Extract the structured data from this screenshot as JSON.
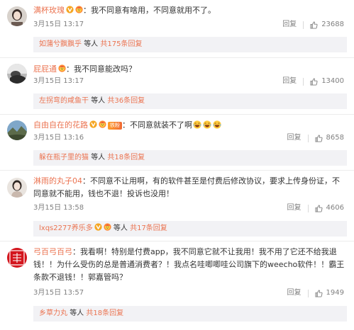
{
  "comments": [
    {
      "username": "满杯玫瑰",
      "text": "我不同意有啥用，不同意就用不了。",
      "date": "3月15日 13:17",
      "reply_label": "回复",
      "likes": "23688",
      "sub": {
        "users": [
          "如蒲兮飘飘乎"
        ],
        "etc": "等人",
        "more": "共175条回复"
      }
    },
    {
      "username": "屁屁通",
      "text": "我不同意能改吗？",
      "date": "3月15日 13:17",
      "reply_label": "回复",
      "likes": "13400",
      "sub": {
        "users": [
          "左拐弯的咸鱼干"
        ],
        "etc": "等人",
        "more": "共36条回复"
      }
    },
    {
      "username": "自由自在的花路",
      "medal": "铁粉",
      "text": "不同意就装不了啊",
      "date": "3月15日 13:16",
      "reply_label": "回复",
      "likes": "8658",
      "sub": {
        "users": [
          "躲在瓶子里的猫"
        ],
        "etc": "等人",
        "more": "共18条回复"
      }
    },
    {
      "username": "淋雨的丸子04",
      "text": "不同意不让用啊，有的软件甚至是付费后修改协议，要求上传身份证，不同意就不能用，钱也不退！投诉也没用！",
      "date": "3月15日 13:58",
      "reply_label": "回复",
      "likes": "4606",
      "sub": {
        "users": [
          "lxqs2277养乐多"
        ],
        "etc": "等人",
        "more": "共17条回复"
      }
    },
    {
      "username": "弓百弓百弓",
      "text": "我看啊！特别是付费app，我不同意它就不让我用！我不用了它还不给我退钱！！为什么受伤的总是普通消费者？！我点名哇唧唧哇公司旗下的weecho软件！！霸王条款不退钱！！郭嘉管吗？",
      "date": "3月15日 13:57",
      "reply_label": "回复",
      "likes": "1949",
      "sub": {
        "users": [
          "乡草力丸"
        ],
        "etc": "等人",
        "more": "共18条回复"
      }
    }
  ],
  "icons": {
    "verified": "orange-v-badge",
    "vip": "vip-face-badge",
    "like": "thumbs-up-icon",
    "emoji_laugh": "laughing-emoji"
  },
  "colors": {
    "username": "#eb7350",
    "meta": "#808080",
    "subbar_bg": "#f2f2f5",
    "verified": "#f5a623"
  }
}
